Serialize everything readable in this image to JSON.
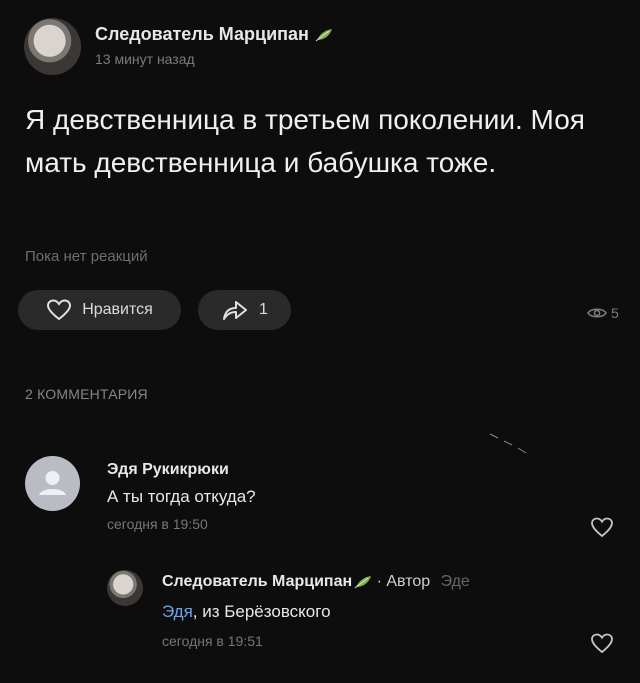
{
  "post": {
    "author": "Следователь Марципан",
    "time": "13 минут назад",
    "text": "Я девственница в третьем поколении. Моя мать девственница и бабушка тоже.",
    "reactions_text": "Пока нет реакций",
    "like_label": "Нравится",
    "share_count": "1",
    "views_count": "5"
  },
  "comments": {
    "header": "2 КОММЕНТАРИЯ",
    "first": {
      "author": "Эдя Рукикрюки",
      "text": "А ты тогда откуда?",
      "time": "сегодня в 19:50"
    },
    "reply": {
      "author": "Следователь Марципан",
      "author_tag": "· Автор",
      "trail": "Эде",
      "mention": "Эдя",
      "text": ", из Берёзовского",
      "time": "сегодня в 19:51"
    }
  },
  "icons": {
    "leaf": "leaf-icon",
    "heart": "heart-icon",
    "share": "share-icon",
    "eye": "eye-icon",
    "avatar_placeholder": "user-icon"
  },
  "colors": {
    "background": "#0d0d0d",
    "pill": "#2a2a2a",
    "link": "#6ba6ea",
    "leaf": "#7fb24a"
  }
}
